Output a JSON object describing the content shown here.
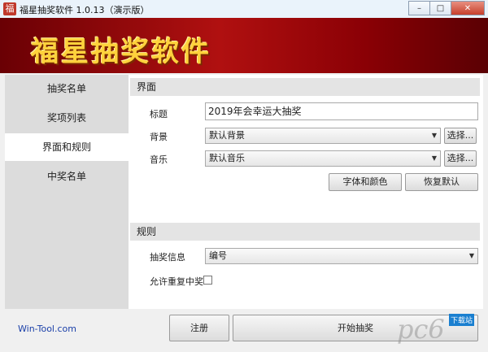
{
  "window": {
    "title": "福星抽奖软件 1.0.13（演示版）",
    "icon_text": "福",
    "minimize": "–",
    "maximize": "□",
    "close": "✕"
  },
  "banner": {
    "title": "福星抽奖软件"
  },
  "sidebar": {
    "items": [
      {
        "label": "抽奖名单"
      },
      {
        "label": "奖项列表"
      },
      {
        "label": "界面和规则"
      },
      {
        "label": "中奖名单"
      }
    ]
  },
  "interface": {
    "section_title": "界面",
    "title_label": "标题",
    "title_value": "2019年会幸运大抽奖",
    "background_label": "背景",
    "background_value": "默认背景",
    "music_label": "音乐",
    "music_value": "默认音乐",
    "browse_label": "选择...",
    "font_color_button": "字体和颜色",
    "restore_default_button": "恢复默认"
  },
  "rules": {
    "section_title": "规则",
    "draw_info_label": "抽奖信息",
    "draw_info_value": "编号",
    "allow_repeat_label": "允许重复中奖",
    "allow_repeat_checked": false
  },
  "footer": {
    "link": "Win-Tool.com",
    "register_button": "注册",
    "start_button": "开始抽奖"
  },
  "watermark": {
    "text": "pc6",
    "small": "下载站"
  },
  "colors": {
    "banner": "#b01010",
    "banner_text": "#ffd23c",
    "link": "#1a3fa8"
  }
}
